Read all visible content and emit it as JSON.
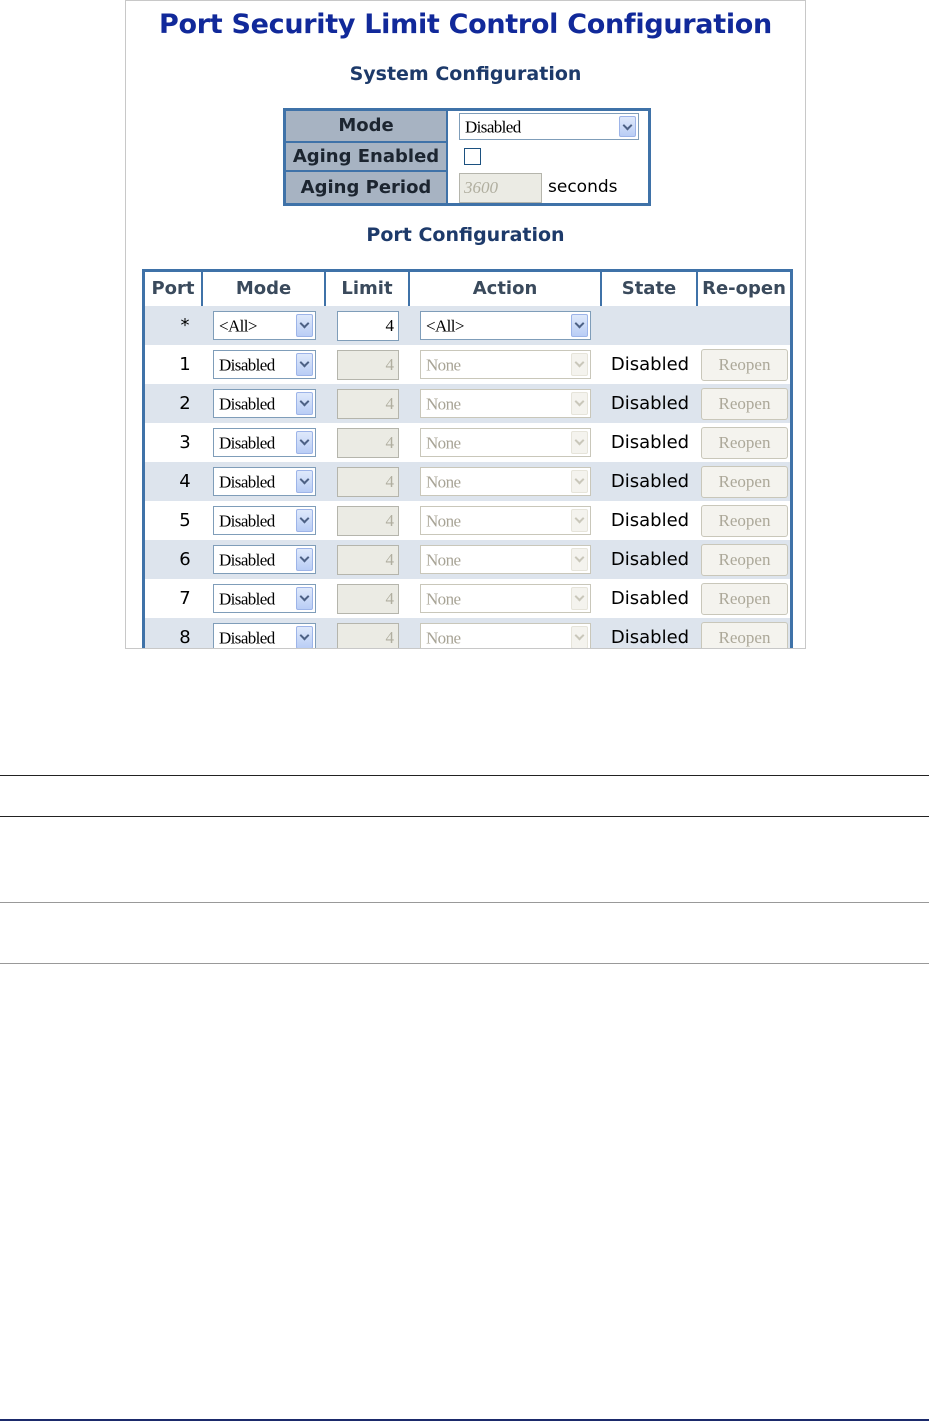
{
  "title": "Port Security Limit Control Configuration",
  "system": {
    "heading": "System Configuration",
    "mode_label": "Mode",
    "mode_value": "Disabled",
    "aging_enabled_label": "Aging Enabled",
    "aging_enabled_checked": false,
    "aging_period_label": "Aging Period",
    "aging_period_value": "3600",
    "aging_period_unit": "seconds"
  },
  "ports": {
    "heading": "Port Configuration",
    "columns": [
      "Port",
      "Mode",
      "Limit",
      "Action",
      "State",
      "Re-open"
    ],
    "all_row": {
      "port": "*",
      "mode": "<All>",
      "limit": "4",
      "action": "<All>"
    },
    "rows": [
      {
        "port": "1",
        "mode": "Disabled",
        "limit": "4",
        "action": "None",
        "state": "Disabled",
        "reopen": "Reopen"
      },
      {
        "port": "2",
        "mode": "Disabled",
        "limit": "4",
        "action": "None",
        "state": "Disabled",
        "reopen": "Reopen"
      },
      {
        "port": "3",
        "mode": "Disabled",
        "limit": "4",
        "action": "None",
        "state": "Disabled",
        "reopen": "Reopen"
      },
      {
        "port": "4",
        "mode": "Disabled",
        "limit": "4",
        "action": "None",
        "state": "Disabled",
        "reopen": "Reopen"
      },
      {
        "port": "5",
        "mode": "Disabled",
        "limit": "4",
        "action": "None",
        "state": "Disabled",
        "reopen": "Reopen"
      },
      {
        "port": "6",
        "mode": "Disabled",
        "limit": "4",
        "action": "None",
        "state": "Disabled",
        "reopen": "Reopen"
      },
      {
        "port": "7",
        "mode": "Disabled",
        "limit": "4",
        "action": "None",
        "state": "Disabled",
        "reopen": "Reopen"
      },
      {
        "port": "8",
        "mode": "Disabled",
        "limit": "4",
        "action": "None",
        "state": "Disabled",
        "reopen": "Reopen"
      }
    ]
  },
  "colors": {
    "title": "#11299a",
    "table_border": "#3f72a8",
    "label_bg": "#a7b3c2",
    "row_alt_bg": "#dde4ed",
    "footer_rule": "#1b2a6b"
  },
  "icons": [
    "dropdown-arrow-icon"
  ]
}
